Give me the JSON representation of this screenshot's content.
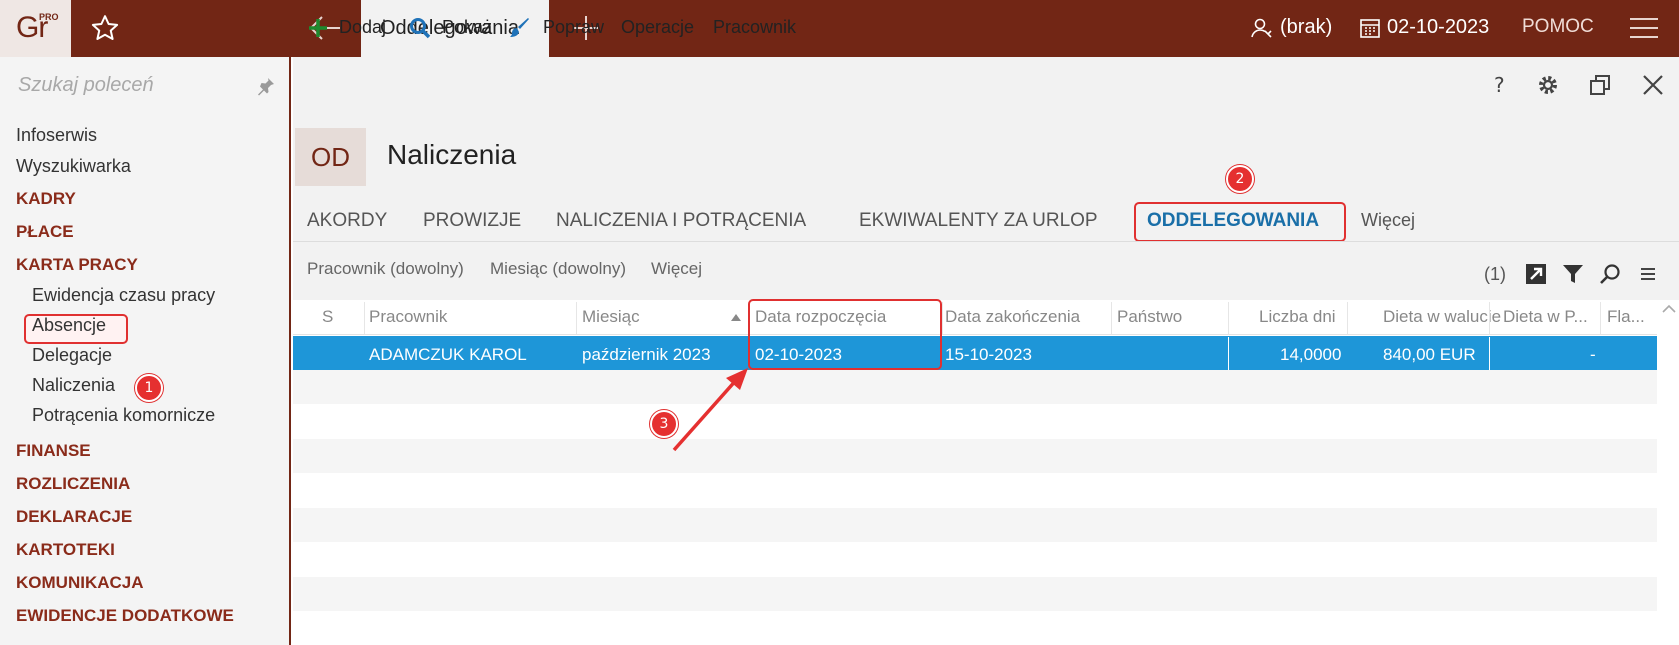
{
  "app": {
    "logo_text": "Gr",
    "logo_badge": "PRO"
  },
  "topbar": {
    "active_tab": "Oddelegowania",
    "user": "(brak)",
    "date": "02-10-2023",
    "help": "POMOC"
  },
  "sidebar": {
    "search_placeholder": "Szukaj poleceń",
    "items": [
      {
        "label": "Infoserwis",
        "type": "plain"
      },
      {
        "label": "Wyszukiwarka",
        "type": "plain"
      },
      {
        "label": "KADRY",
        "type": "section"
      },
      {
        "label": "PŁACE",
        "type": "section"
      },
      {
        "label": "KARTA PRACY",
        "type": "section"
      },
      {
        "label": "Ewidencja czasu pracy",
        "type": "sub"
      },
      {
        "label": "Absencje",
        "type": "sub"
      },
      {
        "label": "Delegacje",
        "type": "sub"
      },
      {
        "label": "Naliczenia",
        "type": "sub",
        "active": true
      },
      {
        "label": "Potrącenia komornicze",
        "type": "sub"
      },
      {
        "label": "FINANSE",
        "type": "section"
      },
      {
        "label": "ROZLICZENIA",
        "type": "section"
      },
      {
        "label": "DEKLARACJE",
        "type": "section"
      },
      {
        "label": "KARTOTEKI",
        "type": "section"
      },
      {
        "label": "KOMUNIKACJA",
        "type": "section"
      },
      {
        "label": "EWIDENCJE DODATKOWE",
        "type": "section"
      }
    ]
  },
  "toolbar": {
    "add": "Dodaj",
    "show": "Pokaż",
    "edit": "Popraw",
    "operations": "Operacje",
    "employee": "Pracownik"
  },
  "page": {
    "badge": "OD",
    "title": "Naliczenia",
    "tabs": [
      "AKORDY",
      "PROWIZJE",
      "NALICZENIA I POTRĄCENIA",
      "EKWIWALENTY ZA URLOP",
      "ODDELEGOWANIA",
      "Więcej"
    ],
    "active_tab": "ODDELEGOWANIA",
    "filters": [
      "Pracownik (dowolny)",
      "Miesiąc (dowolny)",
      "Więcej"
    ],
    "count": "(1)"
  },
  "grid": {
    "columns": [
      "S",
      "Pracownik",
      "Miesiąc",
      "Data rozpoczęcia",
      "Data zakończenia",
      "Państwo",
      "Liczba dni",
      "Dieta w walucie",
      "Dieta w P...",
      "Fla..."
    ],
    "rows": [
      {
        "s": "",
        "employee": "ADAMCZUK KAROL",
        "month": "październik 2023",
        "start": "02-10-2023",
        "end": "15-10-2023",
        "country": "",
        "days": "14,0000",
        "diet_currency": "840,00 EUR",
        "diet_pln": "-",
        "flag": ""
      }
    ]
  },
  "annotations": [
    "1",
    "2",
    "3"
  ],
  "colors": {
    "brand": "#722615",
    "selection": "#1e96d8",
    "highlight": "#e03030",
    "active_tab": "#1a6fa8"
  }
}
